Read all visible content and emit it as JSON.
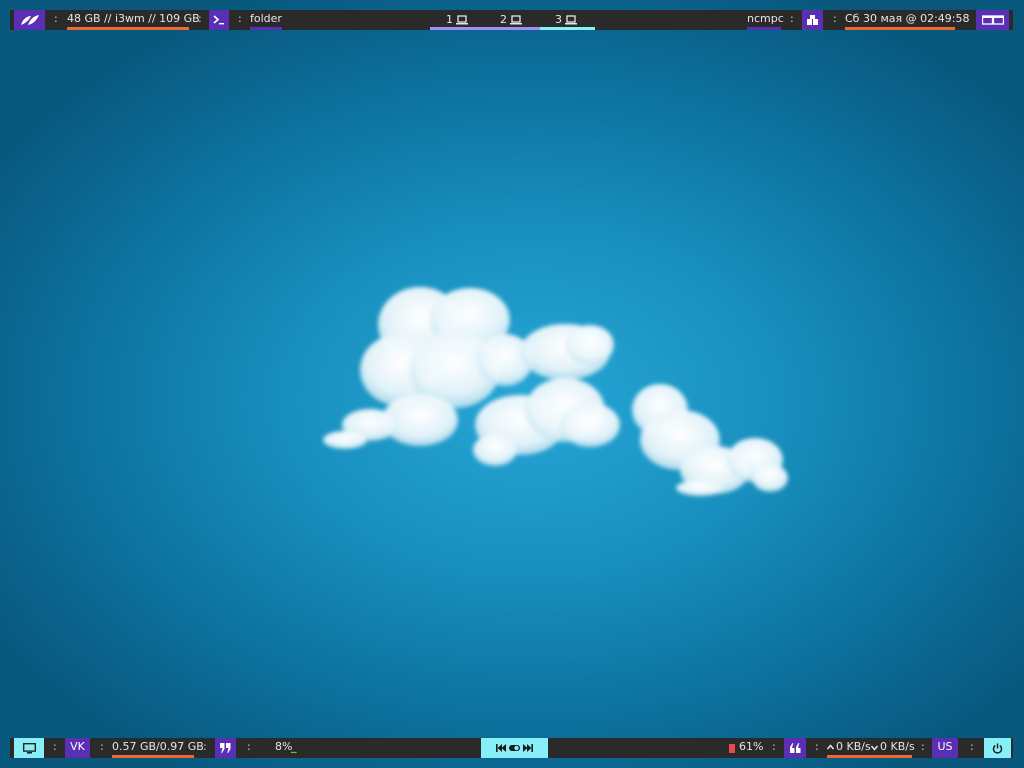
{
  "top_bar": {
    "disk_usage": "48 GB // i3wm // 109 GB",
    "folder_label": "folder",
    "workspaces": [
      "1",
      "2",
      "3"
    ],
    "player_label": "ncmpc",
    "datetime": "Сб 30 мая @ 02:49:58",
    "separator": ":"
  },
  "bottom_bar": {
    "layout_label": "VK",
    "memory": "0.57 GB/0.97 GB",
    "cpu": "8%",
    "cpu_graph": "_",
    "battery": "61%",
    "network": "0 KB/s",
    "network_down": "0 KB/s",
    "keyboard_layout": "US",
    "separator": ":"
  },
  "icons": {
    "launcher": "leaf-icon",
    "terminal": "terminal-icon",
    "workspace": "laptop-icon",
    "player": "package-icon",
    "calendar": "window-icon",
    "display": "monitor-icon",
    "quote": "quote-icon",
    "media": "media-controls-icon",
    "power": "power-icon"
  },
  "colors": {
    "bar_background": "#2a2a2a",
    "accent_purple": "#5b2fb3",
    "accent_cyan": "#88eef8",
    "underline_orange": "#f2662f",
    "underline_lilac": "#a38cf2",
    "desktop_center": "#27a6d6",
    "desktop_edge": "#08587e",
    "battery_red": "#e94b4b"
  }
}
